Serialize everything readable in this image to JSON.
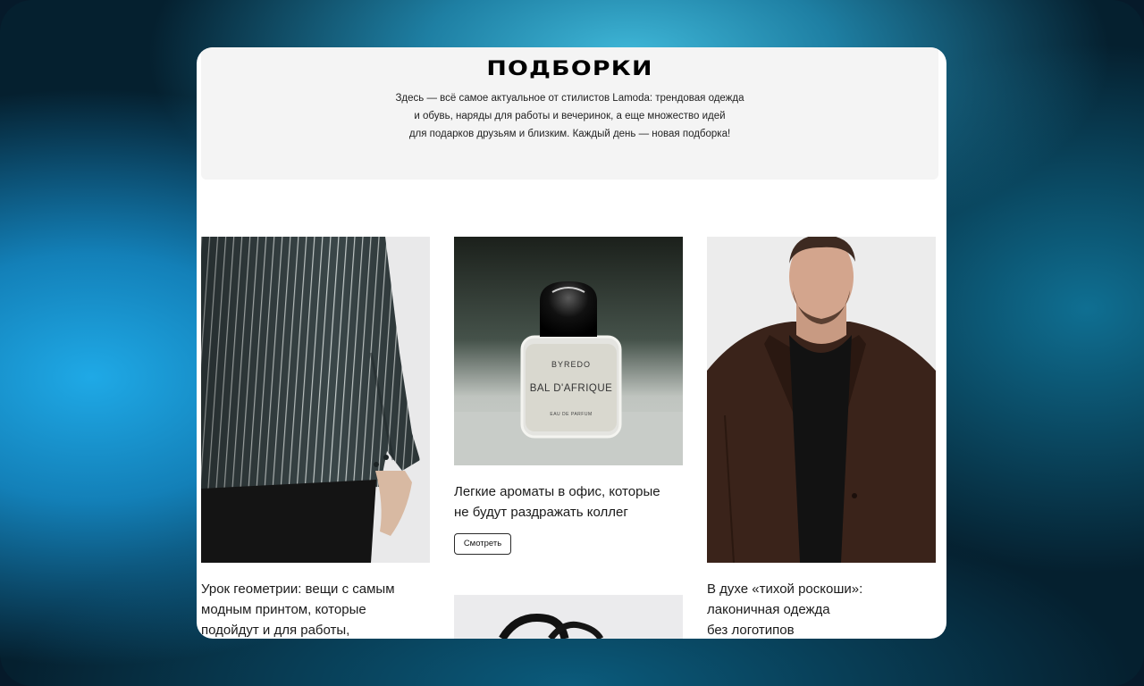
{
  "hero": {
    "title": "ПОДБОРКИ",
    "line1": "Здесь — всё самое актуальное от стилистов Lamoda: трендовая одежда",
    "line2": "и обувь, наряды для работы и вечеринок, а еще множество идей",
    "line3": "для подарков друзьям и близким. Каждый день — новая подборка!"
  },
  "cards": [
    {
      "title_lines": [
        "Урок геометрии: вещи с самым",
        "модным принтом, которые",
        "подойдут и для работы,"
      ]
    },
    {
      "title_lines": [
        "Легкие ароматы в офис, которые",
        "не будут раздражать коллег"
      ],
      "button": "Смотреть",
      "bottle": {
        "brand": "BYREDO",
        "name": "BAL D'AFRIQUE",
        "sub": "EAU DE PARFUM"
      }
    },
    {
      "title_lines": [
        "В духе «тихой роскоши»:",
        "лаконичная одежда",
        "без логотипов"
      ]
    }
  ]
}
